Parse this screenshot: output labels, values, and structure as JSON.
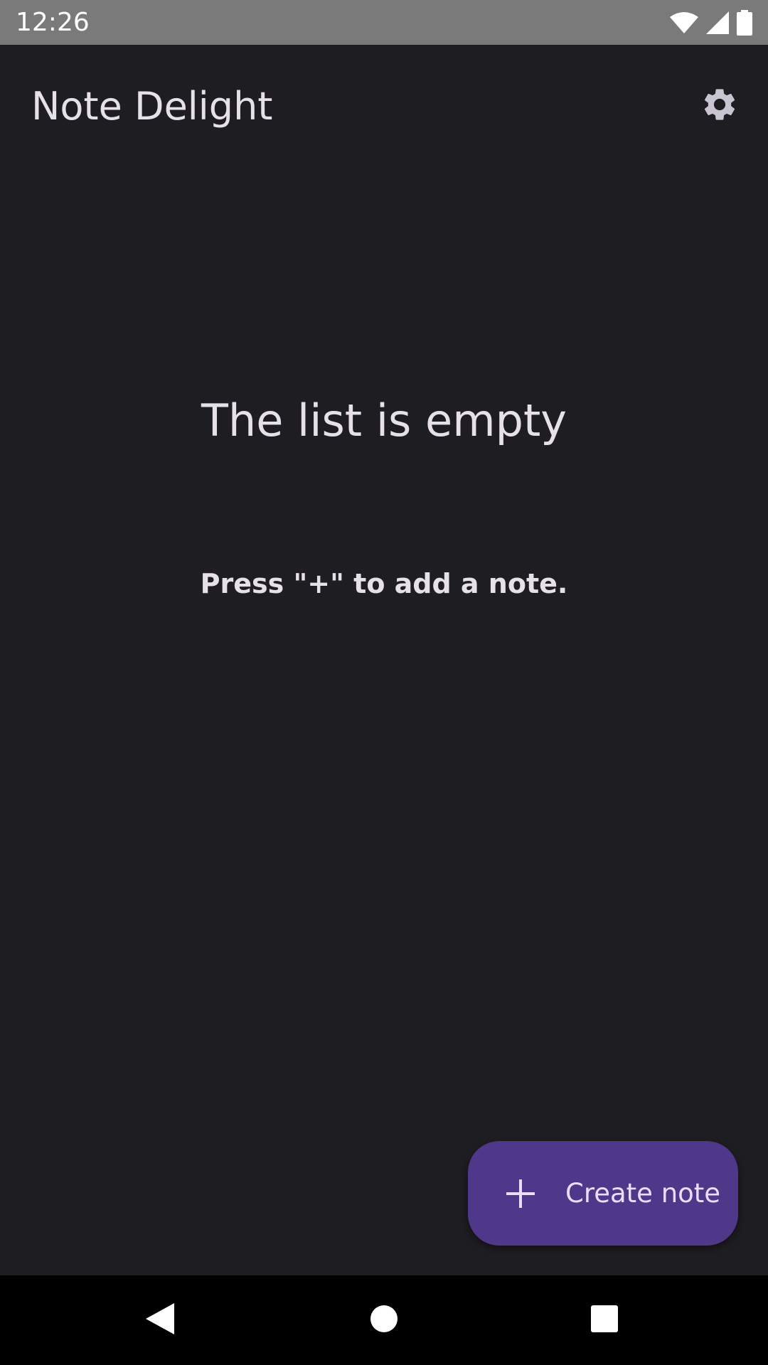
{
  "status_bar": {
    "time": "12:26",
    "icons": [
      "wifi-icon",
      "cell-signal-icon",
      "battery-icon"
    ]
  },
  "app_bar": {
    "title": "Note Delight",
    "settings_icon": "gear-icon"
  },
  "empty_state": {
    "title": "The list is empty",
    "subtitle": "Press \"+\" to add a note."
  },
  "fab": {
    "icon": "plus-icon",
    "label": "Create note"
  },
  "nav_bar": {
    "buttons": [
      "back-icon",
      "home-icon",
      "recents-icon"
    ]
  },
  "colors": {
    "background": "#1e1d22",
    "status_bar": "#7a7a7a",
    "fab_background": "#4f378a",
    "fab_foreground": "#eaddff",
    "text": "#e6e1e8",
    "icon": "#c9c5d0"
  }
}
